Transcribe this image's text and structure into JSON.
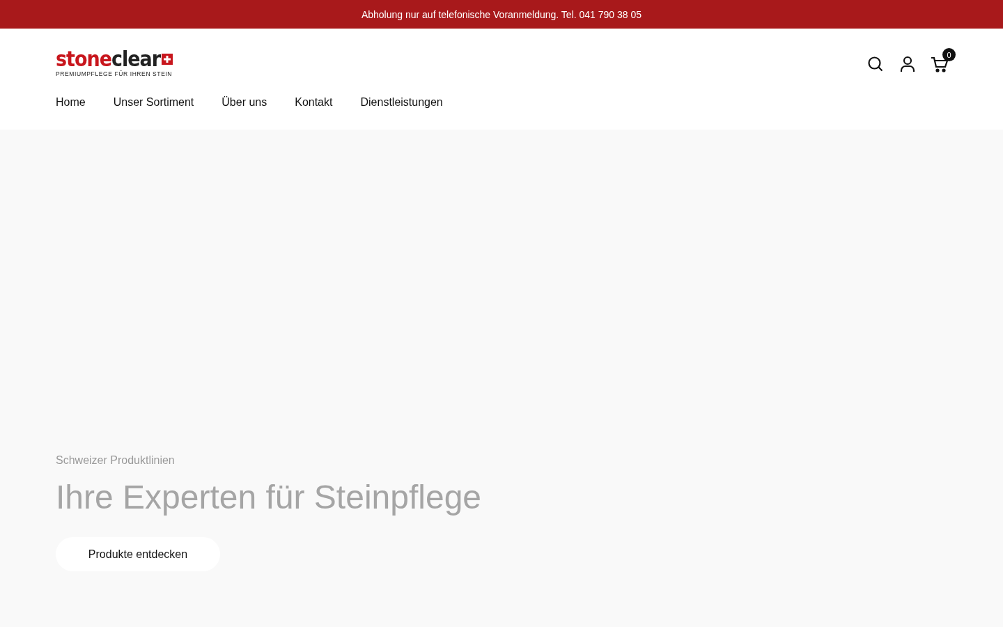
{
  "announcement": "Abholung nur auf telefonische Voranmeldung. Tel. 041 790 38 05",
  "logo": {
    "part_1": "stone",
    "part_2": "clear",
    "tagline": "PREMIUMPFLEGE FÜR IHREN STEIN"
  },
  "cart": {
    "count": "0"
  },
  "nav": [
    {
      "label": "Home"
    },
    {
      "label": "Unser Sortiment"
    },
    {
      "label": "Über uns"
    },
    {
      "label": "Kontakt"
    },
    {
      "label": "Dienstleistungen"
    }
  ],
  "hero": {
    "eyebrow": "Schweizer Produktlinien",
    "title": "Ihre Experten für Steinpflege",
    "button": "Produkte entdecken"
  }
}
